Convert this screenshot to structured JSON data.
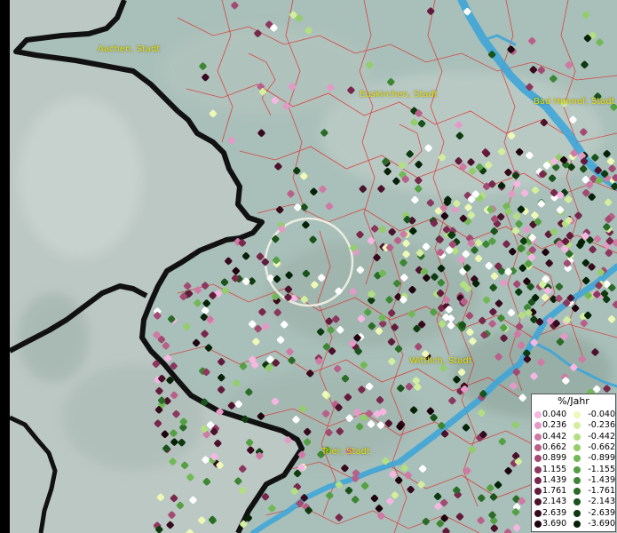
{
  "map": {
    "places": [
      {
        "name": "Aachen, Stadt"
      },
      {
        "name": "Euskirchen, Stadt"
      },
      {
        "name": "Bad Honnef, Stadt"
      },
      {
        "name": "Wittlich, Stadt"
      },
      {
        "name": "Trier, Stadt"
      }
    ],
    "colors": {
      "terrain": "#a9bfb9",
      "foreign_area": "#bcc8c4",
      "country_border": "#111111",
      "district_lines": "#e03030",
      "rivers": "#3fa6d8",
      "label_color": "#e7e000",
      "highlight_circle": "#f2f2e6"
    }
  },
  "legend": {
    "title": "%/Jahr",
    "positive": [
      {
        "value": "0.040",
        "color": "#f5b7e1"
      },
      {
        "value": "0.236",
        "color": "#e49ac6"
      },
      {
        "value": "0.442",
        "color": "#cf7aa5"
      },
      {
        "value": "0.662",
        "color": "#b9608a"
      },
      {
        "value": "0.899",
        "color": "#a34a72"
      },
      {
        "value": "1.155",
        "color": "#8c385e"
      },
      {
        "value": "1.439",
        "color": "#77284b"
      },
      {
        "value": "1.761",
        "color": "#621b3a"
      },
      {
        "value": "2.143",
        "color": "#4c112b"
      },
      {
        "value": "2.639",
        "color": "#36091c"
      },
      {
        "value": "3.690",
        "color": "#1e030e"
      }
    ],
    "negative": [
      {
        "value": "-0.040",
        "color": "#eef9b8"
      },
      {
        "value": "-0.236",
        "color": "#d3ee9d"
      },
      {
        "value": "-0.442",
        "color": "#b3df83"
      },
      {
        "value": "-0.662",
        "color": "#93cd6c"
      },
      {
        "value": "-0.899",
        "color": "#73b857"
      },
      {
        "value": "-1.155",
        "color": "#55a044"
      },
      {
        "value": "-1.439",
        "color": "#3d8634"
      },
      {
        "value": "-1.761",
        "color": "#2a6c27"
      },
      {
        "value": "-2.143",
        "color": "#1a521b"
      },
      {
        "value": "-2.639",
        "color": "#0e3a10"
      },
      {
        "value": "-3.690",
        "color": "#052207"
      }
    ]
  }
}
